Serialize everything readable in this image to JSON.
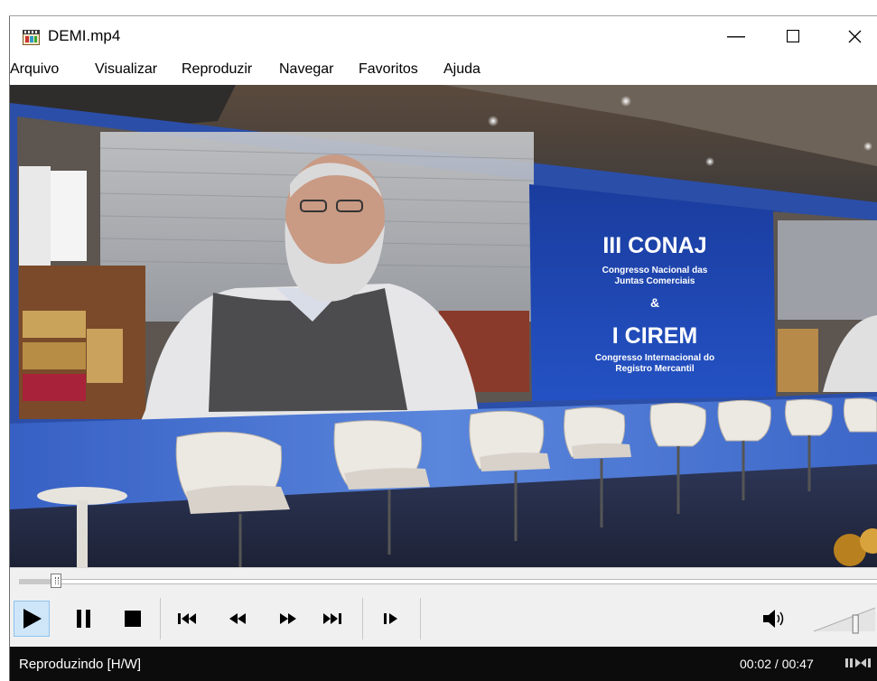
{
  "window": {
    "title": "DEMI.mp4",
    "minimize_glyph": "—",
    "maximize_glyph": "☐",
    "close_glyph": "✕"
  },
  "menu": {
    "items": [
      "Arquivo",
      "Visualizar",
      "Reproduzir",
      "Navegar",
      "Favoritos",
      "Ajuda"
    ]
  },
  "video": {
    "banner_title": "III CONAJ",
    "banner_sub1": "Congresso Nacional das",
    "banner_sub2": "Juntas Comerciais",
    "banner_amp": "&",
    "banner_title2": "I CIREM",
    "banner_sub3": "Congresso Internacional do",
    "banner_sub4": "Registro Mercantil"
  },
  "playback": {
    "position_fraction": 0.043,
    "volume_fraction": 0.7
  },
  "controls": {
    "icons": [
      "play-icon",
      "pause-icon",
      "stop-icon",
      "previous-icon",
      "rewind-icon",
      "fast-forward-icon",
      "next-icon",
      "frame-step-icon",
      "volume-icon"
    ]
  },
  "status": {
    "text": "Reproduzindo [H/W]",
    "time": "00:02 / 00:47"
  },
  "colors": {
    "status_bg": "#0c0c0c",
    "controls_bg": "#f0f0f0",
    "active_button": "#cfe6f8",
    "banner_blue": "#1c44b0"
  }
}
